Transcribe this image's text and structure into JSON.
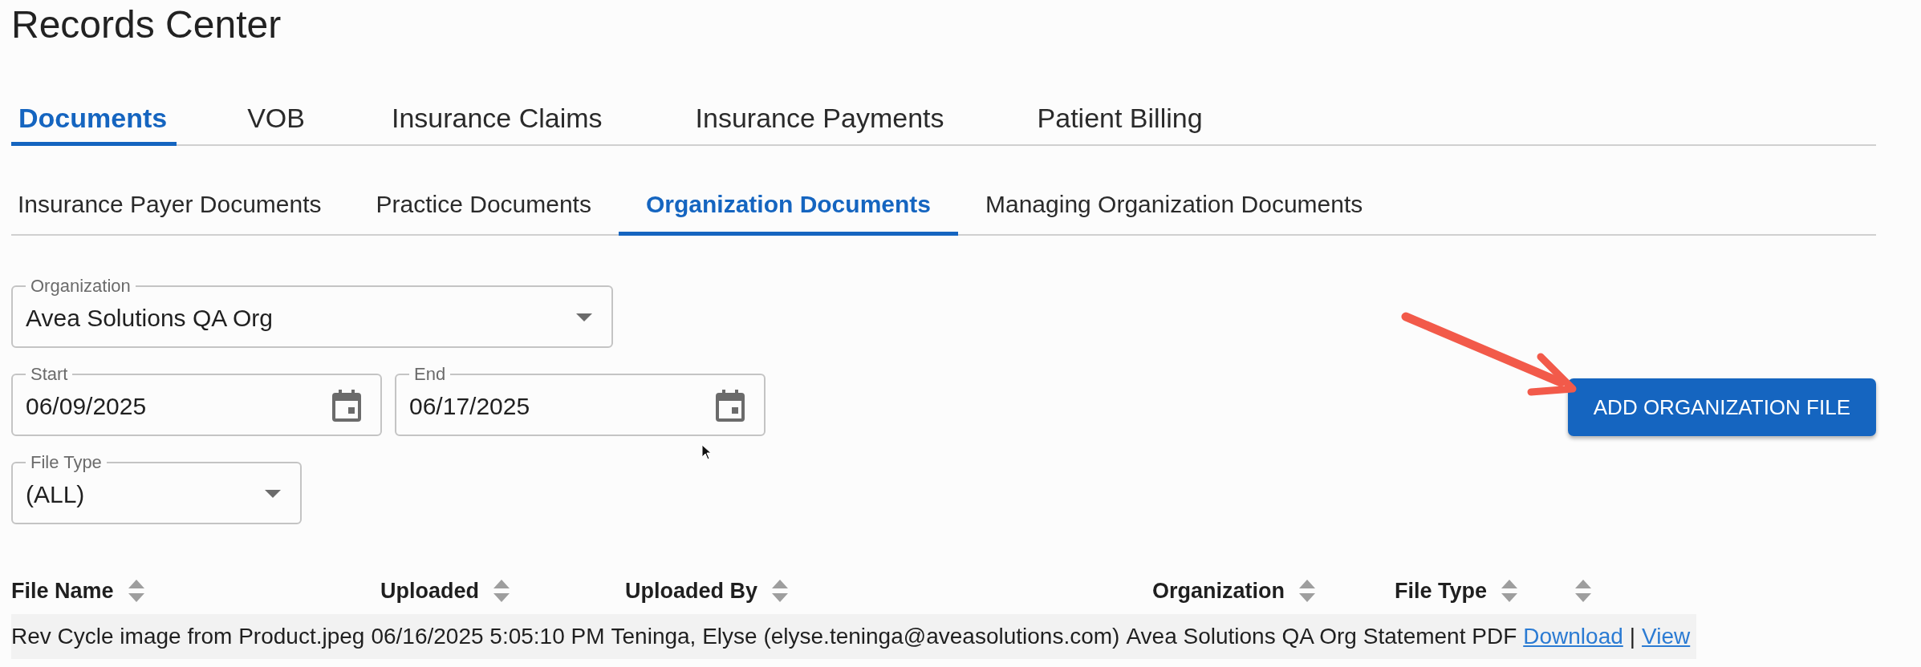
{
  "page_title": "Records Center",
  "main_tabs": [
    {
      "label": "Documents",
      "selected": true
    },
    {
      "label": "VOB",
      "selected": false
    },
    {
      "label": "Insurance Claims",
      "selected": false
    },
    {
      "label": "Insurance Payments",
      "selected": false
    },
    {
      "label": "Patient Billing",
      "selected": false
    }
  ],
  "sub_tabs": [
    {
      "label": "Insurance Payer Documents",
      "selected": false
    },
    {
      "label": "Practice Documents",
      "selected": false
    },
    {
      "label": "Organization Documents",
      "selected": true
    },
    {
      "label": "Managing Organization Documents",
      "selected": false
    }
  ],
  "filter_rows": [
    [
      {
        "kind": "select",
        "label": "Organization",
        "value": "Avea Solutions QA Org"
      }
    ],
    [
      {
        "kind": "date",
        "label": "Start",
        "value": "06/09/2025"
      },
      {
        "kind": "date",
        "label": "End",
        "value": "06/17/2025"
      }
    ],
    [
      {
        "kind": "select",
        "label": "File Type",
        "value": "(ALL)"
      }
    ]
  ],
  "add_button": "ADD ORGANIZATION FILE",
  "table": {
    "columns": [
      "File Name",
      "Uploaded",
      "Uploaded By",
      "Organization",
      "File Type"
    ],
    "actions_column_sortable": true,
    "rows": [
      {
        "cells": [
          "Rev Cycle image from Product.jpeg",
          "06/16/2025 5:05:10 PM",
          "Teninga, Elyse (elyse.teninga@aveasolutions.com)",
          "Avea Solutions QA Org",
          "Statement PDF"
        ],
        "links": [
          "Download",
          "View"
        ],
        "separator": "|"
      }
    ]
  }
}
